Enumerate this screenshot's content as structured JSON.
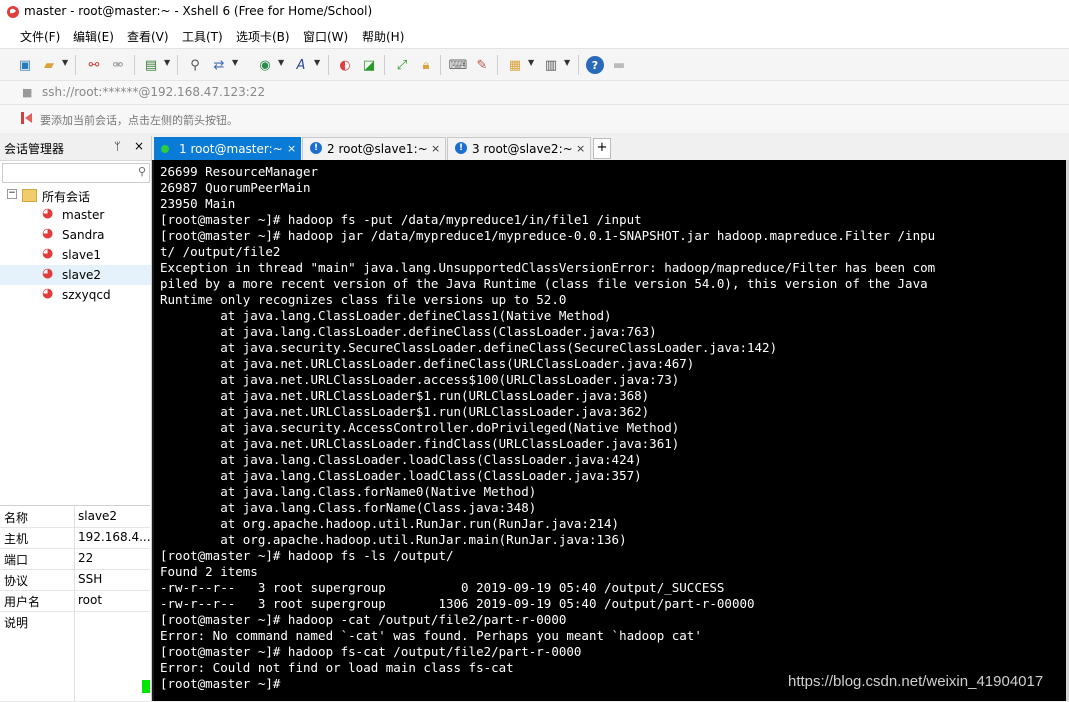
{
  "window": {
    "title": "master - root@master:~ - Xshell 6 (Free for Home/School)"
  },
  "menu": [
    "文件(F)",
    "编辑(E)",
    "查看(V)",
    "工具(T)",
    "选项卡(B)",
    "窗口(W)",
    "帮助(H)"
  ],
  "address": {
    "value": "ssh://root:******@192.168.47.123:22"
  },
  "hint": {
    "text": "要添加当前会话，点击左侧的箭头按钮。"
  },
  "sidebar": {
    "title": "会话管理器",
    "pin": "ᛘ",
    "close": "×",
    "root": "所有会话",
    "sessions": [
      "master",
      "Sandra",
      "slave1",
      "slave2",
      "szxyqcd"
    ],
    "selected": "slave2"
  },
  "properties": [
    {
      "key": "名称",
      "value": "slave2"
    },
    {
      "key": "主机",
      "value": "192.168.4..."
    },
    {
      "key": "端口",
      "value": "22"
    },
    {
      "key": "协议",
      "value": "SSH"
    },
    {
      "key": "用户名",
      "value": "root"
    },
    {
      "key": "说明",
      "value": ""
    }
  ],
  "tabs": [
    {
      "label": "1 root@master:~",
      "active": true,
      "status_color": "#2ecc40"
    },
    {
      "label": "2 root@slave1:~",
      "active": false
    },
    {
      "label": "3 root@slave2:~",
      "active": false
    }
  ],
  "terminal": {
    "lines": [
      "26699 ResourceManager",
      "26987 QuorumPeerMain",
      "23950 Main",
      "[root@master ~]# hadoop fs -put /data/mypreduce1/in/file1 /input",
      "[root@master ~]# hadoop jar /data/mypreduce1/mypreduce-0.0.1-SNAPSHOT.jar hadoop.mapreduce.Filter /inpu",
      "t/ /output/file2",
      "Exception in thread \"main\" java.lang.UnsupportedClassVersionError: hadoop/mapreduce/Filter has been com",
      "piled by a more recent version of the Java Runtime (class file version 54.0), this version of the Java",
      "Runtime only recognizes class file versions up to 52.0",
      "        at java.lang.ClassLoader.defineClass1(Native Method)",
      "        at java.lang.ClassLoader.defineClass(ClassLoader.java:763)",
      "        at java.security.SecureClassLoader.defineClass(SecureClassLoader.java:142)",
      "        at java.net.URLClassLoader.defineClass(URLClassLoader.java:467)",
      "        at java.net.URLClassLoader.access$100(URLClassLoader.java:73)",
      "        at java.net.URLClassLoader$1.run(URLClassLoader.java:368)",
      "        at java.net.URLClassLoader$1.run(URLClassLoader.java:362)",
      "        at java.security.AccessController.doPrivileged(Native Method)",
      "        at java.net.URLClassLoader.findClass(URLClassLoader.java:361)",
      "        at java.lang.ClassLoader.loadClass(ClassLoader.java:424)",
      "        at java.lang.ClassLoader.loadClass(ClassLoader.java:357)",
      "        at java.lang.Class.forName0(Native Method)",
      "        at java.lang.Class.forName(Class.java:348)",
      "        at org.apache.hadoop.util.RunJar.run(RunJar.java:214)",
      "        at org.apache.hadoop.util.RunJar.main(RunJar.java:136)",
      "[root@master ~]# hadoop fs -ls /output/",
      "Found 2 items",
      "-rw-r--r--   3 root supergroup          0 2019-09-19 05:40 /output/_SUCCESS",
      "-rw-r--r--   3 root supergroup       1306 2019-09-19 05:40 /output/part-r-00000",
      "[root@master ~]# hadoop -cat /output/file2/part-r-0000",
      "Error: No command named `-cat' was found. Perhaps you meant `hadoop cat'",
      "[root@master ~]# hadoop fs-cat /output/file2/part-r-0000",
      "Error: Could not find or load main class fs-cat",
      "[root@master ~]# "
    ],
    "cursor_color": "#00e600"
  },
  "watermark": "https://blog.csdn.net/weixin_41904017",
  "toolbar_icons": [
    "new-session-icon",
    "open-folder-icon",
    "reconnect-icon",
    "disconnect-icon",
    "properties-icon",
    "find-icon",
    "transfer-icon",
    "globe-icon",
    "font-icon",
    "xshell-icon",
    "xftp-icon",
    "fullscreen-icon",
    "lock-icon",
    "keyboard-icon",
    "compose-icon",
    "script-icon",
    "layout-icon",
    "help-icon",
    "chat-icon"
  ]
}
